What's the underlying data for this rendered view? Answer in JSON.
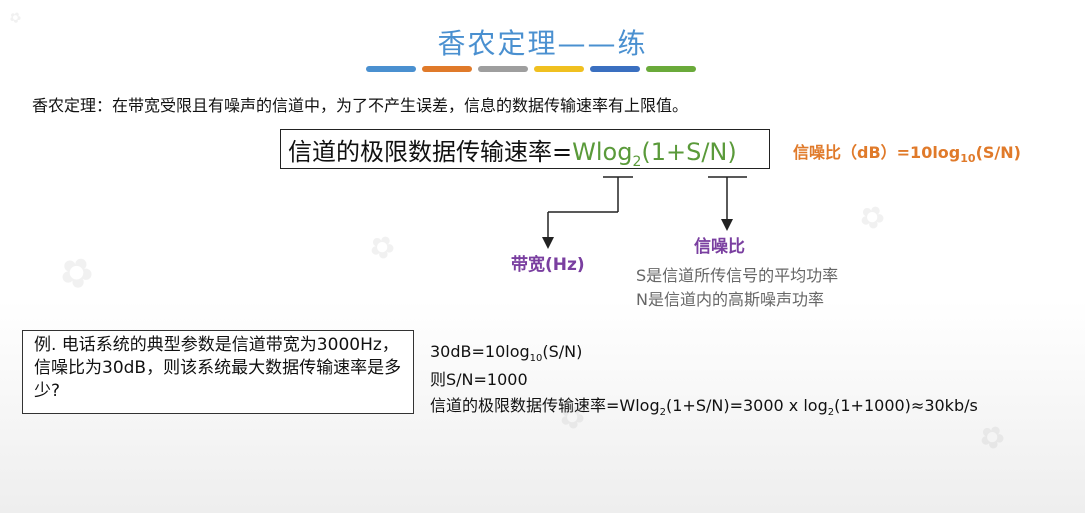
{
  "title": "香农定理——练",
  "color_bars": [
    "#4a90d0",
    "#e07a2a",
    "#9e9e9e",
    "#f0c020",
    "#3a6fc0",
    "#6aaa3a"
  ],
  "intro": "香农定理：在带宽受限且有噪声的信道中，为了不产生误差，信息的数据传输速率有上限值。",
  "formula": {
    "prefix": "信道的极限数据传输速率=",
    "green_before_sub": "Wlog",
    "sub": "2",
    "green_after_sub": "(1+S/N)"
  },
  "snr_formula": {
    "before_sub": "信噪比（dB）=10log",
    "sub": "10",
    "after_sub": "(S/N)"
  },
  "labels": {
    "bandwidth": "带宽(Hz)",
    "snr": "信噪比"
  },
  "snr_notes": [
    "S是信道所传信号的平均功率",
    "N是信道内的高斯噪声功率"
  ],
  "example": "例. 电话系统的典型参数是信道带宽为3000Hz，信噪比为30dB，则该系统最大数据传输速率是多少?",
  "solution": {
    "line1_a": "30dB=10log",
    "line1_sub": "10",
    "line1_b": "(S/N)",
    "line2": "则S/N=1000",
    "line3_a": "信道的极限数据传输速率=Wlog",
    "line3_sub1": "2",
    "line3_b": "(1+S/N)=3000 x log",
    "line3_sub2": "2",
    "line3_c": "(1+1000)≈30kb/s"
  },
  "watermark_icon": "university-logo-watermark"
}
